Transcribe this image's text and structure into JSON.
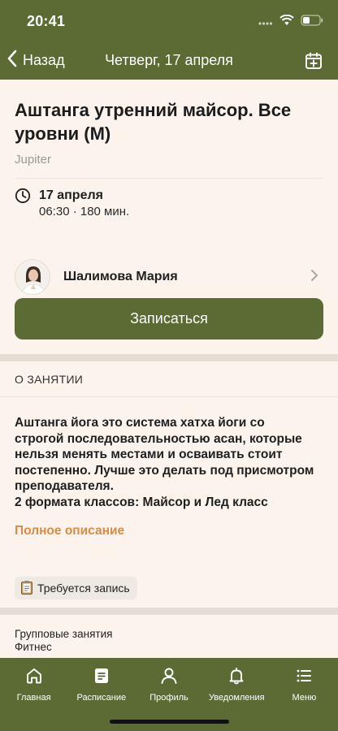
{
  "status_bar": {
    "time": "20:41"
  },
  "nav": {
    "back_label": "Назад",
    "title": "Четверг, 17 апреля"
  },
  "event": {
    "title": "Аштанга утренний майсор. Все уровни (М)",
    "location": "Jupiter",
    "date": "17 апреля",
    "time_duration": "06:30 · 180 мин."
  },
  "teacher": {
    "name": "Шалимова Мария"
  },
  "actions": {
    "signup_label": "Записаться"
  },
  "about": {
    "heading": "О ЗАНЯТИИ",
    "text_lines": [
      "Аштанга йога это система хатха йоги со",
      "строгой последовательностью асан, которые",
      "нельзя менять местами и осваивать стоит",
      "постепенно. Лучше это делать под присмотром",
      "преподавателя.",
      "2 формата классов: Майсор и Лед класс"
    ],
    "full_description_link": "Полное описание"
  },
  "tag": {
    "icon": "clipboard-icon",
    "label": "Требуется запись"
  },
  "categories": [
    "Групповые занятия",
    "Фитнес"
  ],
  "tabbar": {
    "items": [
      {
        "label": "Главная",
        "icon": "home-icon"
      },
      {
        "label": "Расписание",
        "icon": "schedule-icon"
      },
      {
        "label": "Профиль",
        "icon": "profile-icon"
      },
      {
        "label": "Уведомления",
        "icon": "bell-icon"
      },
      {
        "label": "Меню",
        "icon": "menu-icon"
      }
    ]
  },
  "colors": {
    "brand_green": "#5b6b33",
    "link_orange": "#d98b45",
    "background": "#fbf3ec"
  }
}
